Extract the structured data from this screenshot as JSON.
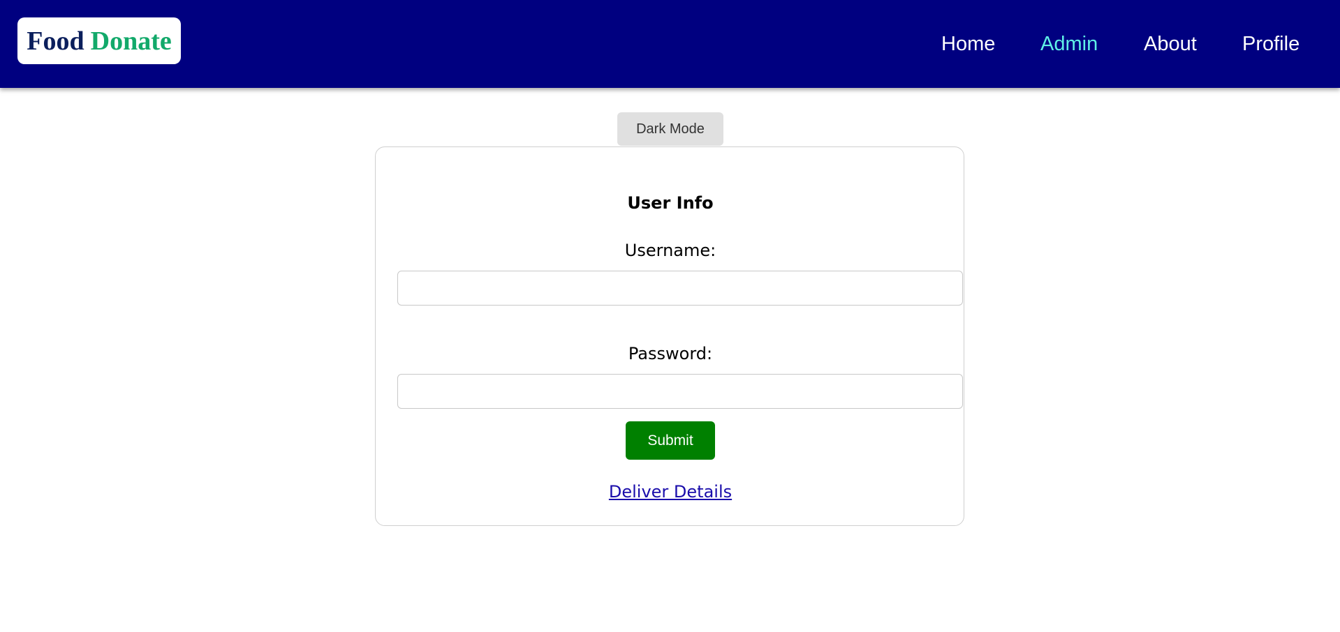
{
  "brand": {
    "logo_word_1": "Food",
    "logo_word_2": "Donate",
    "logo_color_1": "#0b1f5c",
    "logo_color_2": "#12a96a"
  },
  "header": {
    "background": "#000080",
    "nav": [
      {
        "label": "Home",
        "active": false
      },
      {
        "label": "Admin",
        "active": true
      },
      {
        "label": "About",
        "active": false
      },
      {
        "label": "Profile",
        "active": false
      }
    ],
    "active_color": "#5ff0e6"
  },
  "theme_toggle": {
    "label": "Dark Mode"
  },
  "form": {
    "title": "User Info",
    "username_label": "Username:",
    "username_value": "",
    "password_label": "Password:",
    "password_value": "",
    "submit_label": "Submit",
    "submit_color": "#008000",
    "link_label": "Deliver Details"
  }
}
